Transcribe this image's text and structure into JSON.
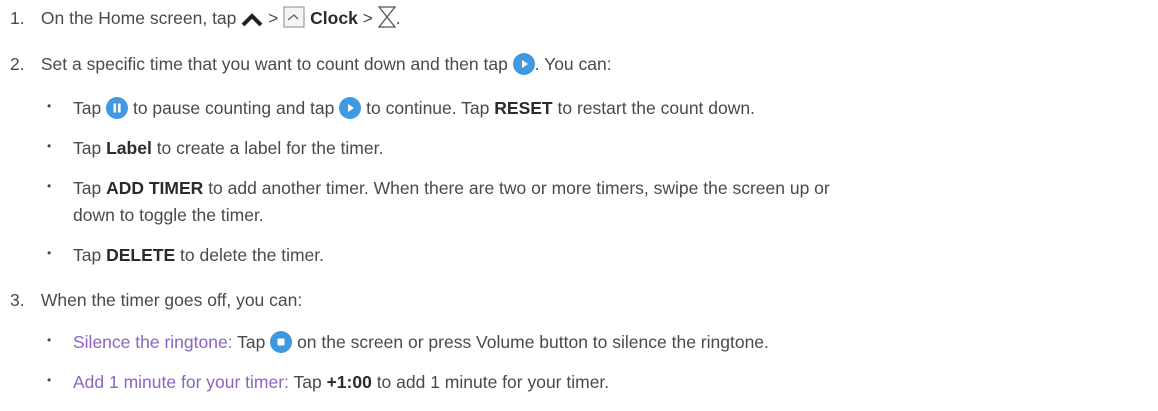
{
  "steps": [
    {
      "num": "1.",
      "t1": "On the Home screen, tap",
      "sep1": ">",
      "clock_label": "Clock",
      "sep2": ">",
      "end": "."
    },
    {
      "num": "2.",
      "t1": "Set a specific time that you want to count down and then tap",
      "t2": ". You can:"
    },
    {
      "num": "3.",
      "t1": "When the timer goes off, you can:"
    }
  ],
  "step2_bullets": {
    "b1": {
      "p1": "Tap",
      "p2": "to pause counting and tap",
      "p3": "to continue. Tap",
      "strong": "RESET",
      "p4": "to restart the count down."
    },
    "b2": {
      "p1": "Tap",
      "strong": "Label",
      "p2": "to create a label for the timer."
    },
    "b3": {
      "p1": "Tap",
      "strong": "ADD TIMER",
      "p2": "to add another timer. When there are two or more timers, swipe the screen up or",
      "p3": "down to toggle the timer."
    },
    "b4": {
      "p1": "Tap",
      "strong": "DELETE",
      "p2": "to delete the timer."
    }
  },
  "step3_bullets": {
    "b1": {
      "accent": "Silence the ringtone:",
      "p1": "Tap",
      "p2": "on the screen or press Volume button to silence the ringtone."
    },
    "b2": {
      "accent": "Add 1 minute for your timer:",
      "p1": "Tap",
      "strong": "+1:00",
      "p2": "to add 1 minute for your timer."
    }
  },
  "bullet_char": "•",
  "icons": {
    "up": "chevron-up-icon",
    "app": "clock-app-icon",
    "timer": "hourglass-icon",
    "play": "play-icon",
    "pause": "pause-icon",
    "stop": "stop-icon"
  },
  "colors": {
    "text": "#4a4a4a",
    "accent": "#8b63c2",
    "icon_blue": "#3f98e0"
  }
}
